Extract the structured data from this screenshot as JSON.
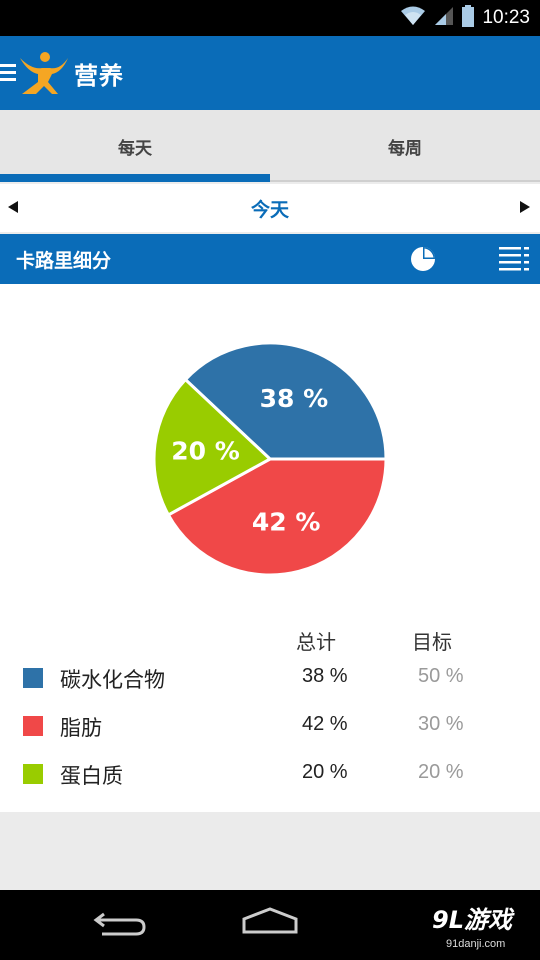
{
  "status_bar": {
    "time": "10:23"
  },
  "app_bar": {
    "title": "营养"
  },
  "tabs": [
    {
      "label": "每天",
      "selected": true
    },
    {
      "label": "每周",
      "selected": false
    }
  ],
  "date_nav": {
    "label": "今天"
  },
  "section": {
    "title": "卡路里细分"
  },
  "legend": {
    "total_header": "总计",
    "goal_header": "目标",
    "rows": [
      {
        "label": "碳水化合物",
        "total": "38 %",
        "goal": "50 %",
        "color": "#2e72a8"
      },
      {
        "label": "脂肪",
        "total": "42 %",
        "goal": "30 %",
        "color": "#f04848"
      },
      {
        "label": "蛋白质",
        "total": "20 %",
        "goal": "20 %",
        "color": "#99cc00"
      }
    ]
  },
  "chart_data": {
    "type": "pie",
    "categories": [
      "碳水化合物",
      "脂肪",
      "蛋白质"
    ],
    "values": [
      38,
      42,
      20
    ],
    "labels": [
      "38 %",
      "42 %",
      "20 %"
    ],
    "colors": [
      "#2e72a8",
      "#f04848",
      "#99cc00"
    ],
    "title": ""
  },
  "watermark": {
    "text": "9L游戏",
    "sub": "91danji.com"
  },
  "colors": {
    "primary": "#0a6cb8",
    "status_bar": "#000000",
    "nav_bar": "#000000"
  },
  "icons": {
    "menu": "menu-icon",
    "logo": "logo-icon",
    "wifi": "wifi-icon",
    "signal": "signal-icon",
    "battery": "battery-icon",
    "pie_view": "pie-chart-icon",
    "list_view": "list-icon",
    "back": "back-icon",
    "home": "home-icon"
  }
}
